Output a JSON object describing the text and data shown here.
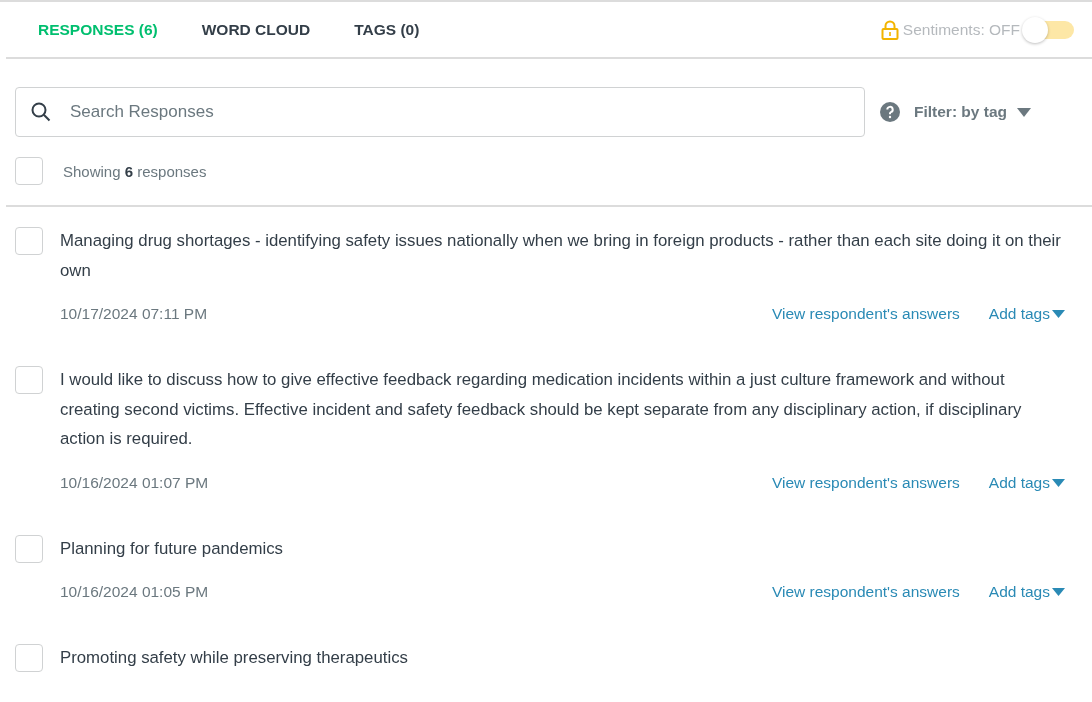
{
  "tabs": [
    {
      "label": "RESPONSES (6)",
      "selected": true
    },
    {
      "label": "WORD CLOUD",
      "selected": false
    },
    {
      "label": "TAGS (0)",
      "selected": false
    }
  ],
  "sentiments": {
    "label": "Sentiments: OFF",
    "on": false
  },
  "search": {
    "placeholder": "Search Responses"
  },
  "filter": {
    "label": "Filter: by tag"
  },
  "summary": {
    "text": "Showing **6** responses",
    "checked": false
  },
  "responses": [
    {
      "text": "Managing drug shortages - identifying safety issues nationally when we bring in foreign products - rather than each site doing it on their own",
      "date": "10/17/2024 07:11 PM",
      "checked": false,
      "view_link": "View respondent's answers",
      "tags_link": "Add tags"
    },
    {
      "text": "I would like to discuss how to give effective feedback regarding medication incidents within a just culture framework and without creating second victims. Effective incident and safety feedback should be kept separate from any disciplinary action, if disciplinary action is required.",
      "date": "10/16/2024 01:07 PM",
      "checked": false,
      "view_link": "View respondent's answers",
      "tags_link": "Add tags"
    },
    {
      "text": "Planning for future pandemics",
      "date": "10/16/2024 01:05 PM",
      "checked": false,
      "view_link": "View respondent's answers",
      "tags_link": "Add tags"
    },
    {
      "text": "Promoting safety while preserving therapeutics",
      "checked": false
    }
  ]
}
